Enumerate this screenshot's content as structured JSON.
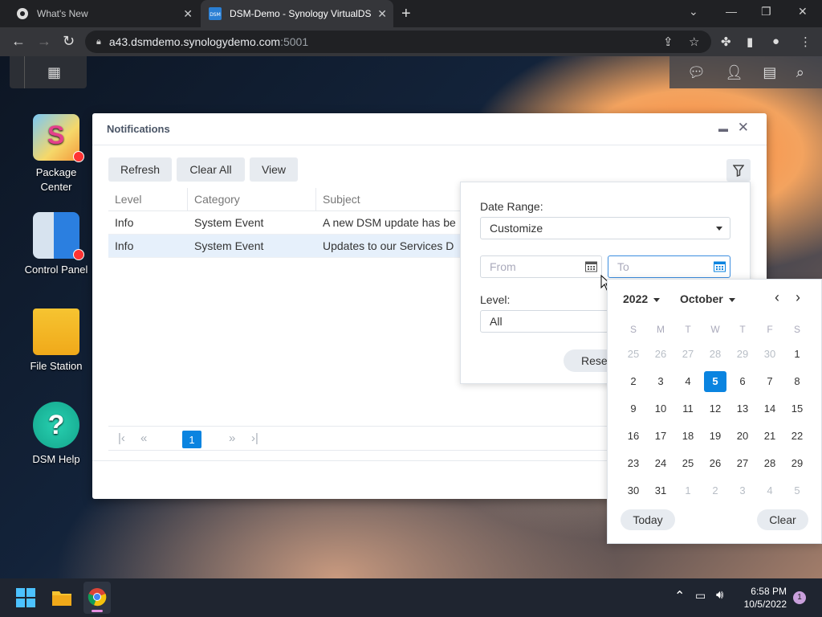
{
  "browser": {
    "tabs": [
      {
        "title": "What's New"
      },
      {
        "title": "DSM-Demo - Synology VirtualDS"
      }
    ],
    "url_host": "a43.dsmdemo.synologydemo.com",
    "url_port": ":5001"
  },
  "desktop": {
    "icons": [
      {
        "label": "Package\nCenter"
      },
      {
        "label": "Control Panel"
      },
      {
        "label": "File Station"
      },
      {
        "label": "DSM Help"
      }
    ]
  },
  "window": {
    "title": "Notifications",
    "buttons": {
      "refresh": "Refresh",
      "clear_all": "Clear All",
      "view": "View"
    },
    "columns": [
      "Level",
      "Category",
      "Subject"
    ],
    "rows": [
      {
        "level": "Info",
        "category": "System Event",
        "subject": "A new DSM update has be"
      },
      {
        "level": "Info",
        "category": "System Event",
        "subject": "Updates to our Services D"
      }
    ],
    "pager": {
      "current_page": "1"
    }
  },
  "filter": {
    "date_range_label": "Date Range:",
    "date_range_value": "Customize",
    "from_placeholder": "From",
    "to_placeholder": "To",
    "level_label": "Level:",
    "level_value": "All",
    "reset_label": "Rese"
  },
  "calendar": {
    "year": "2022",
    "month": "October",
    "weekdays": [
      "S",
      "M",
      "T",
      "W",
      "T",
      "F",
      "S"
    ],
    "weeks": [
      [
        "25",
        "26",
        "27",
        "28",
        "29",
        "30",
        "1"
      ],
      [
        "2",
        "3",
        "4",
        "5",
        "6",
        "7",
        "8"
      ],
      [
        "9",
        "10",
        "11",
        "12",
        "13",
        "14",
        "15"
      ],
      [
        "16",
        "17",
        "18",
        "19",
        "20",
        "21",
        "22"
      ],
      [
        "23",
        "24",
        "25",
        "26",
        "27",
        "28",
        "29"
      ],
      [
        "30",
        "31",
        "1",
        "2",
        "3",
        "4",
        "5"
      ]
    ],
    "selected_day": "5",
    "today_label": "Today",
    "clear_label": "Clear"
  },
  "taskbar": {
    "time": "6:58 PM",
    "date": "10/5/2022",
    "notification_count": "1"
  },
  "colors": {
    "accent": "#0a84e0",
    "selected_row": "#e6f0fb"
  }
}
